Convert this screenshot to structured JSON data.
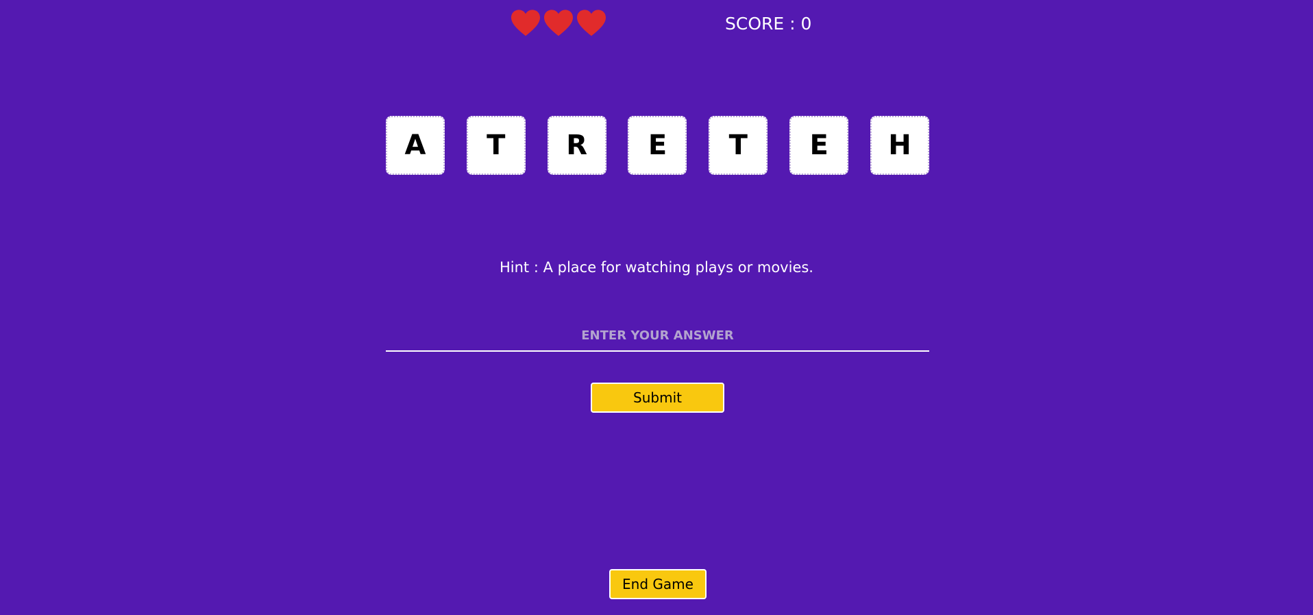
{
  "status": {
    "lives": [
      {
        "icon": "heart-icon",
        "color": "#e12b2b"
      },
      {
        "icon": "heart-icon",
        "color": "#e12b2b"
      },
      {
        "icon": "heart-icon",
        "color": "#e12b2b"
      }
    ],
    "score_text": "SCORE : 0"
  },
  "puzzle": {
    "letters": [
      "A",
      "T",
      "R",
      "E",
      "T",
      "E",
      "H"
    ],
    "hint": "Hint : A place for watching plays or movies."
  },
  "answer": {
    "value": "",
    "placeholder": "ENTER YOUR ANSWER"
  },
  "actions": {
    "submit_label": "Submit",
    "end_game_label": "End Game"
  },
  "colors": {
    "background": "#5419b1",
    "button": "#f9c80f",
    "heart": "#e12b2b",
    "tile": "#ffffff"
  }
}
